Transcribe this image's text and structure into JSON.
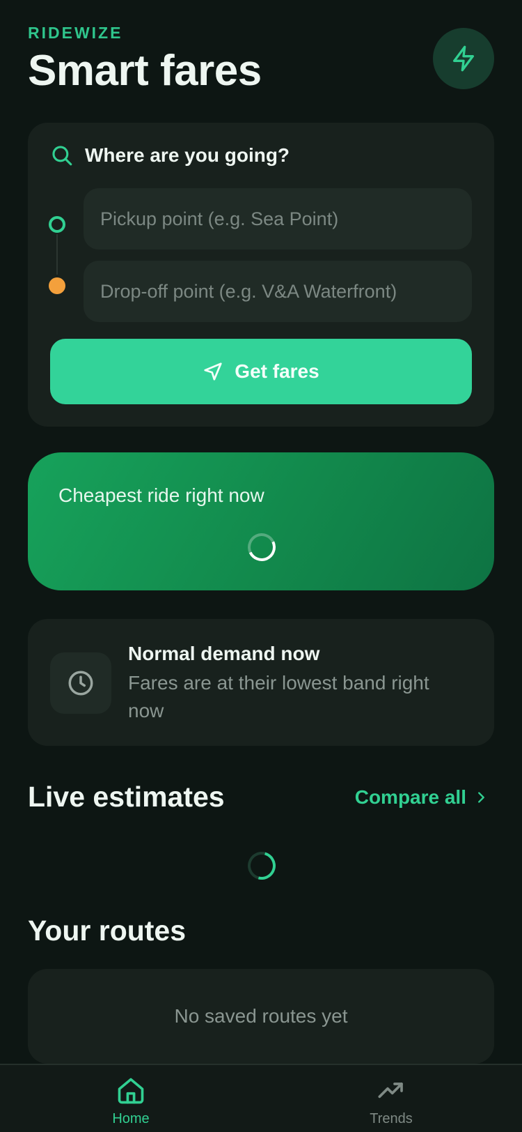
{
  "header": {
    "brand": "RIDEWIZE",
    "title": "Smart fares",
    "action_icon": "lightning-bolt-icon"
  },
  "search": {
    "heading": "Where are you going?",
    "pickup_placeholder": "Pickup point (e.g. Sea Point)",
    "pickup_value": "",
    "dropoff_placeholder": "Drop-off point (e.g. V&A Waterfront)",
    "dropoff_value": "",
    "button_label": "Get fares"
  },
  "cheapest": {
    "label": "Cheapest ride right now",
    "loading": true
  },
  "demand": {
    "title": "Normal demand now",
    "subtitle": "Fares are at their lowest band right now"
  },
  "live_estimates": {
    "title": "Live estimates",
    "compare_label": "Compare all",
    "loading": true
  },
  "routes": {
    "title": "Your routes",
    "empty_text": "No saved routes yet"
  },
  "nav": {
    "home_label": "Home",
    "trends_label": "Trends",
    "active": "Home"
  },
  "colors": {
    "background": "#0d1613",
    "card": "#18211d",
    "accent": "#33d399",
    "dropoff_dot": "#f3a03c",
    "cheapest_card": "#12894c"
  }
}
